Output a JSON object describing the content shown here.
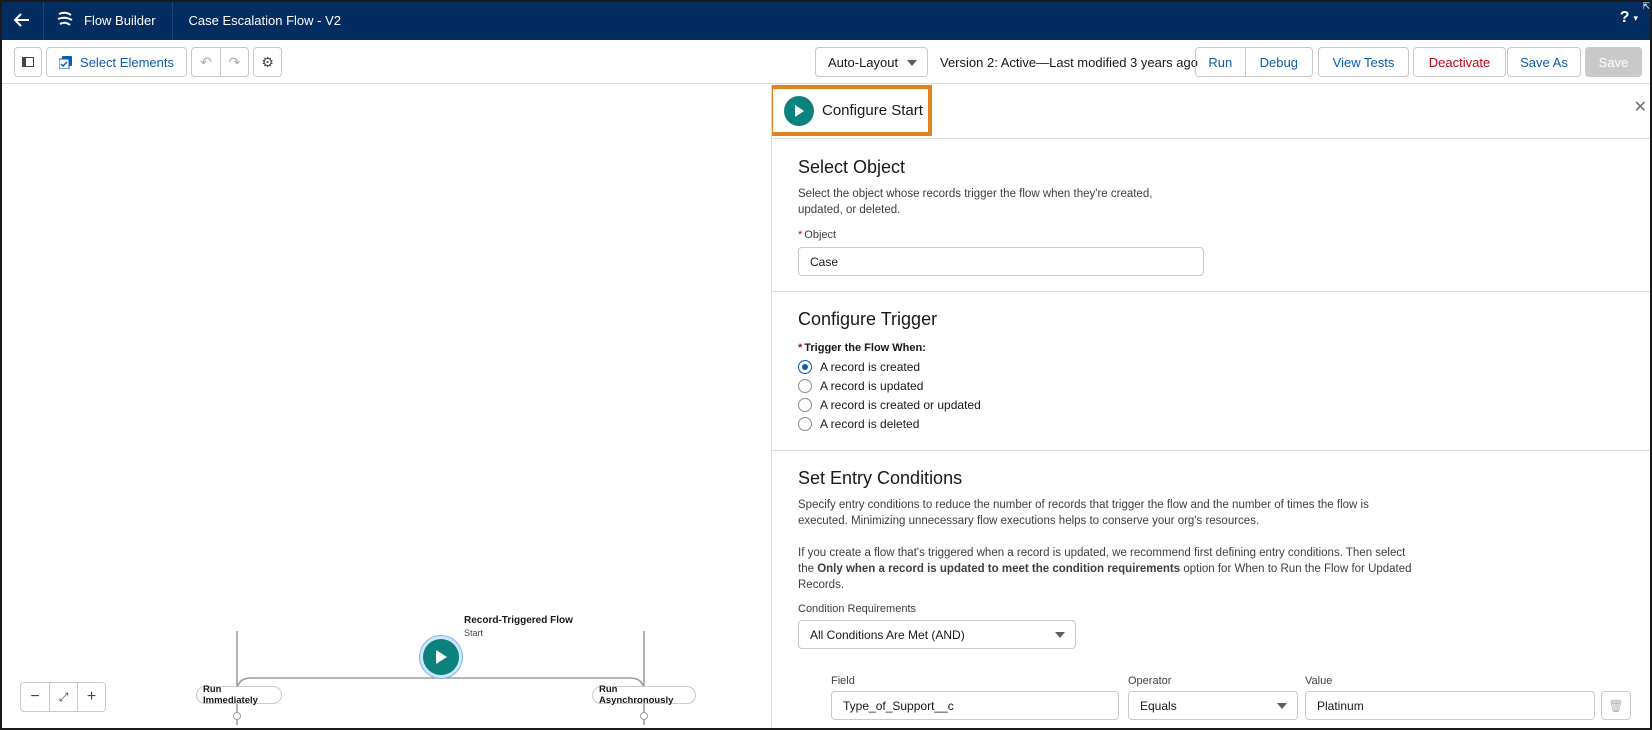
{
  "header": {
    "app_name": "Flow Builder",
    "flow_name": "Case Escalation Flow - V2",
    "help_label": "?"
  },
  "toolbar": {
    "select_elements_label": "Select Elements",
    "layout_select_value": "Auto-Layout",
    "version_status": "Version 2: Active—Last modified 3 years ago",
    "run_label": "Run",
    "debug_label": "Debug",
    "view_tests_label": "View Tests",
    "deactivate_label": "Deactivate",
    "save_as_label": "Save As",
    "save_label": "Save"
  },
  "canvas": {
    "start_node_title": "Record-Triggered Flow",
    "start_node_subtitle": "Start",
    "path_left_label": "Run Immediately",
    "path_right_label": "Run Asynchronously",
    "zoom_out": "−",
    "zoom_in": "+"
  },
  "panel": {
    "title": "Configure Start",
    "select_object": {
      "heading": "Select Object",
      "help_line1": "Select the object whose records trigger the flow when they're created,",
      "help_line2": "updated, or deleted.",
      "object_label": "Object",
      "object_value": "Case"
    },
    "configure_trigger": {
      "heading": "Configure Trigger",
      "trigger_label": "Trigger the Flow When:",
      "options": [
        {
          "label": "A record is created",
          "selected": true
        },
        {
          "label": "A record is updated",
          "selected": false
        },
        {
          "label": "A record is created or updated",
          "selected": false
        },
        {
          "label": "A record is deleted",
          "selected": false
        }
      ]
    },
    "entry_conditions": {
      "heading": "Set Entry Conditions",
      "help_p1_line1": "Specify entry conditions to reduce the number of records that trigger the flow and the number of times the flow is",
      "help_p1_line2": "executed. Minimizing unnecessary flow executions helps to conserve your org's resources.",
      "help_p2_line1": "If you create a flow that's triggered when a record is updated, we recommend first defining entry conditions. Then select",
      "help_p2_line2_pre": "the ",
      "help_p2_line2_bold": "Only when a record is updated to meet the condition requirements",
      "help_p2_line2_post": " option for When to Run the Flow for Updated",
      "help_p2_line3": "Records.",
      "condition_req_label": "Condition Requirements",
      "condition_req_value": "All Conditions Are Met (AND)",
      "field_label": "Field",
      "operator_label": "Operator",
      "value_label": "Value",
      "field_value": "Type_of_Support__c",
      "operator_value": "Equals",
      "value_value": "Platinum"
    }
  },
  "colors": {
    "header_bg": "#032d60",
    "brand_blue": "#0b5cab",
    "start_teal": "#0b827c",
    "highlight_orange": "#e0831f",
    "destructive_red": "#ba0517"
  }
}
